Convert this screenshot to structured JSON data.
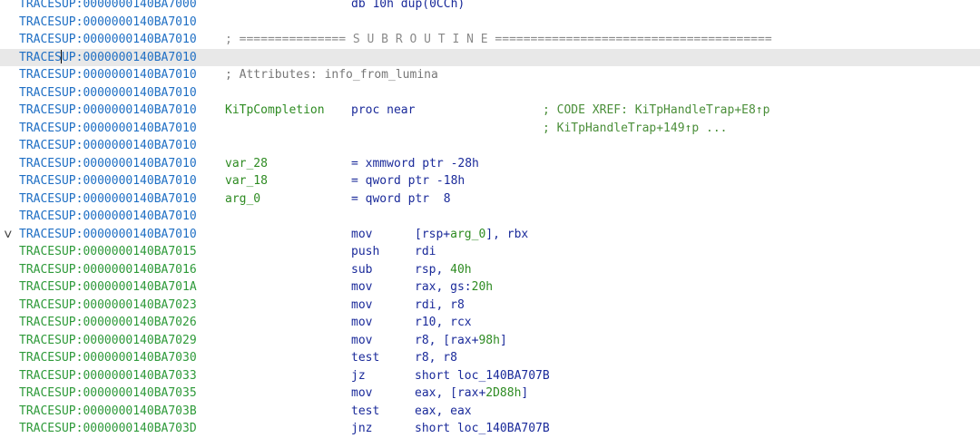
{
  "listing": {
    "rows": [
      {
        "addr": "TRACESUP:0000000140BA7000",
        "kind": "data",
        "label": "",
        "mnem": "db 10h dup(0CCh)",
        "ops": ""
      },
      {
        "addr": "TRACESUP:0000000140BA7010",
        "kind": "data"
      },
      {
        "addr": "TRACESUP:0000000140BA7010",
        "kind": "data",
        "sep": "; =============== S U B R O U T I N E ======================================="
      },
      {
        "addr": "TRACESUP:0000000140BA7010",
        "kind": "data",
        "selected": true
      },
      {
        "addr": "TRACESUP:0000000140BA7010",
        "kind": "data",
        "comment": "; Attributes: info_from_lumina"
      },
      {
        "addr": "TRACESUP:0000000140BA7010",
        "kind": "data"
      },
      {
        "addr": "TRACESUP:0000000140BA7010",
        "kind": "data",
        "label": "KiTpCompletion",
        "proc": "proc near",
        "xref": "; CODE XREF: KiTpHandleTrap+E8↑p"
      },
      {
        "addr": "TRACESUP:0000000140BA7010",
        "kind": "data",
        "xref": "; KiTpHandleTrap+149↑p ..."
      },
      {
        "addr": "TRACESUP:0000000140BA7010",
        "kind": "data"
      },
      {
        "addr": "TRACESUP:0000000140BA7010",
        "kind": "data",
        "label": "var_28",
        "mnem": "= xmmword ptr -28h"
      },
      {
        "addr": "TRACESUP:0000000140BA7010",
        "kind": "data",
        "label": "var_18",
        "mnem": "= qword ptr -18h"
      },
      {
        "addr": "TRACESUP:0000000140BA7010",
        "kind": "data",
        "label": "arg_0",
        "mnem": "= qword ptr  8"
      },
      {
        "addr": "TRACESUP:0000000140BA7010",
        "kind": "data"
      },
      {
        "addr": "TRACESUP:0000000140BA7010",
        "kind": "data",
        "collapse": true,
        "mnem": "mov",
        "ops": "[rsp+arg_0], rbx"
      },
      {
        "addr": "TRACESUP:0000000140BA7015",
        "kind": "code",
        "mnem": "push",
        "ops": "rdi"
      },
      {
        "addr": "TRACESUP:0000000140BA7016",
        "kind": "code",
        "mnem": "sub",
        "ops": "rsp, 40h"
      },
      {
        "addr": "TRACESUP:0000000140BA701A",
        "kind": "code",
        "mnem": "mov",
        "ops": "rax, gs:20h"
      },
      {
        "addr": "TRACESUP:0000000140BA7023",
        "kind": "code",
        "mnem": "mov",
        "ops": "rdi, r8"
      },
      {
        "addr": "TRACESUP:0000000140BA7026",
        "kind": "code",
        "mnem": "mov",
        "ops": "r10, rcx"
      },
      {
        "addr": "TRACESUP:0000000140BA7029",
        "kind": "code",
        "mnem": "mov",
        "ops": "r8, [rax+98h]"
      },
      {
        "addr": "TRACESUP:0000000140BA7030",
        "kind": "code",
        "mnem": "test",
        "ops": "r8, r8"
      },
      {
        "addr": "TRACESUP:0000000140BA7033",
        "kind": "code",
        "mnem": "jz",
        "ops": "short loc_140BA707B"
      },
      {
        "addr": "TRACESUP:0000000140BA7035",
        "kind": "code",
        "mnem": "mov",
        "ops": "eax, [rax+2D88h]"
      },
      {
        "addr": "TRACESUP:0000000140BA703B",
        "kind": "code",
        "mnem": "test",
        "ops": "eax, eax"
      },
      {
        "addr": "TRACESUP:0000000140BA703D",
        "kind": "code",
        "mnem": "jnz",
        "ops": "short loc_140BA707B"
      }
    ]
  },
  "colors": {
    "data_address": "#1f6fc4",
    "code_address": "#2e9a3a",
    "mnemonic": "#1a2a9a",
    "label": "#2e8b22",
    "comment": "#777777",
    "selection": "#e8e8e8"
  },
  "icons": {
    "collapse": "chevron-down-icon"
  }
}
